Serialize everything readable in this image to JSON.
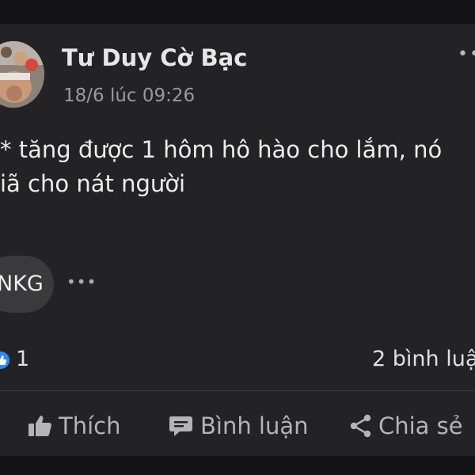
{
  "post": {
    "author": "Tư Duy Cờ Bạc",
    "timestamp": "18/6 lúc 09:26",
    "more_label": "••",
    "text_lines": [
      "* tăng được 1 hôm hô hào cho lắm, nó",
      "iã cho nát người"
    ],
    "tag": "NKG",
    "tag_more": "•••"
  },
  "reactions": {
    "like_count": "1",
    "comment_count": "2 bình luậ"
  },
  "actions": {
    "like_label": "Thích",
    "comment_label": "Bình luận",
    "share_label": "Chia sẻ"
  },
  "colors": {
    "card_bg": "#232325",
    "reaction_blue": "#2d88ff"
  }
}
